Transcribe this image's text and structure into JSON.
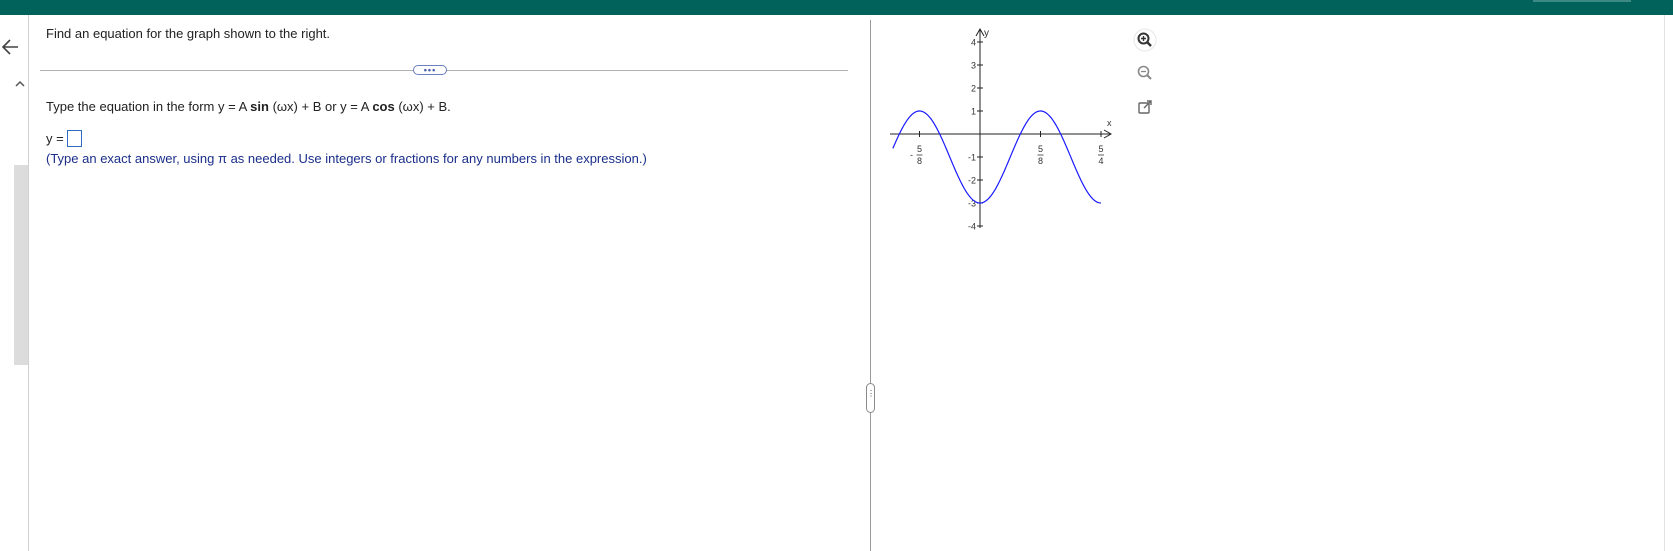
{
  "header": {
    "accent_color": "#00625a"
  },
  "nav": {
    "back_icon": "arrow-left-icon"
  },
  "question": {
    "prompt": "Find an equation for the graph shown to the right.",
    "instruction_prefix": "Type the equation in the form y = A ",
    "instruction_sin": "sin",
    "instruction_mid": " (ωx) + B or y = A ",
    "instruction_cos": "cos",
    "instruction_suffix": " (ωx) + B.",
    "answer_label": "y =",
    "answer_value": "",
    "hint": "(Type an exact answer, using π as needed. Use integers or fractions for any numbers in the expression.)",
    "more_label": "•••"
  },
  "graph": {
    "x_axis_label": "x",
    "y_axis_label": "y",
    "y_ticks": [
      "4",
      "3",
      "2",
      "1",
      "-1",
      "-2",
      "-3",
      "-4"
    ],
    "x_ticks": [
      {
        "num": "5",
        "den": "8",
        "sign": "-"
      },
      {
        "num": "5",
        "den": "8",
        "sign": ""
      },
      {
        "num": "5",
        "den": "4",
        "sign": ""
      }
    ],
    "curve_color": "#1a1aff"
  },
  "chart_data": {
    "type": "line",
    "x_domain": [
      -0.9,
      1.25
    ],
    "ylim": [
      -4,
      4
    ],
    "series": [
      {
        "function": "-1 - 2*cos(8*pi*x/5)",
        "amplitude": 2,
        "midline": -1,
        "period": 1.25,
        "max": 1,
        "min": -3
      }
    ]
  },
  "tools": {
    "zoom_in_icon": "zoom-in-icon",
    "zoom_out_icon": "zoom-out-icon",
    "popout_icon": "external-link-icon"
  }
}
